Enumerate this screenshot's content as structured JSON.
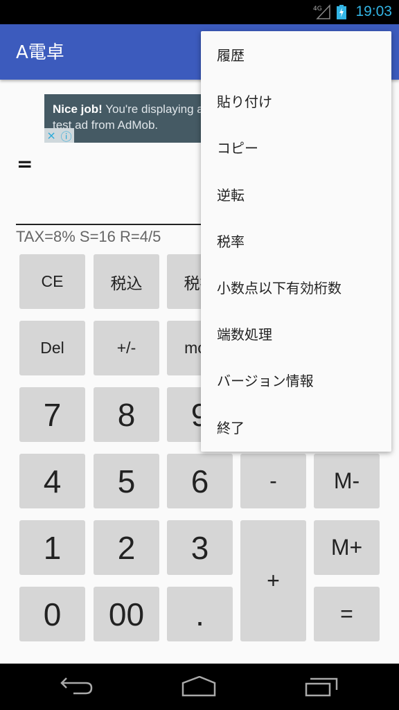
{
  "status_bar": {
    "network": "4G",
    "time": "19:03",
    "time_color": "#33b5e5"
  },
  "app_bar": {
    "title": "A電卓",
    "color": "#3c5bbd"
  },
  "ad": {
    "bold": "Nice job!",
    "text": " You're displaying a",
    "line2": "test ad from AdMob.",
    "close_icon": "×",
    "info_icon": "ⓘ"
  },
  "display": {
    "result": "=",
    "info": "TAX=8% S=16 R=4/5"
  },
  "keypad": {
    "rows": [
      [
        "CE",
        "税込",
        "税抜",
        "",
        ""
      ],
      [
        "Del",
        "+/-",
        "mod",
        "",
        ""
      ],
      [
        "7",
        "8",
        "9",
        "",
        ""
      ],
      [
        "4",
        "5",
        "6",
        "-",
        "M-"
      ],
      [
        "1",
        "2",
        "3",
        "+",
        "M+"
      ],
      [
        "0",
        "00",
        ".",
        "",
        "="
      ]
    ]
  },
  "menu": {
    "items": [
      "履歴",
      "貼り付け",
      "コピー",
      "逆転",
      "税率",
      "小数点以下有効桁数",
      "端数処理",
      "バージョン情報",
      "終了"
    ]
  },
  "nav_bar": {
    "back": "back-icon",
    "home": "home-icon",
    "recents": "recents-icon"
  }
}
